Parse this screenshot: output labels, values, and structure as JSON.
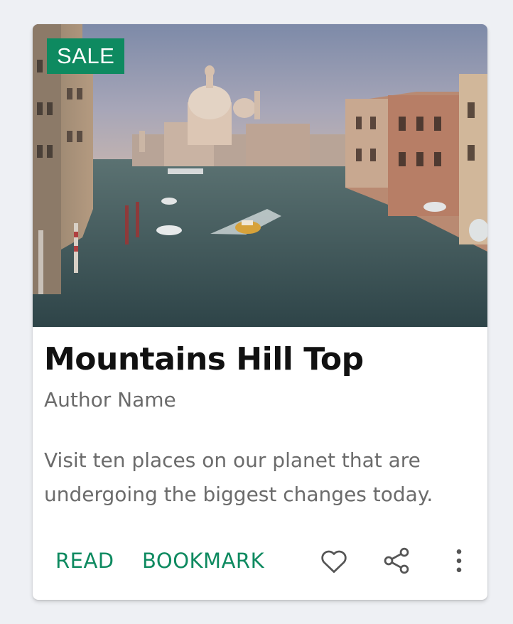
{
  "card": {
    "badge": "SALE",
    "title": "Mountains Hill Top",
    "author": "Author Name",
    "description": "Visit ten places on our planet that are undergoing the biggest changes today.",
    "actions": {
      "read": "READ",
      "bookmark": "BOOKMARK"
    },
    "icons": [
      "heart-icon",
      "share-icon",
      "more-vertical-icon"
    ]
  },
  "colors": {
    "accent": "#0e8a60",
    "badge_bg": "#0e8a60",
    "icon": "#555555",
    "title": "#111111",
    "secondary_text": "#6b6b6b",
    "page_bg": "#eef0f4"
  }
}
